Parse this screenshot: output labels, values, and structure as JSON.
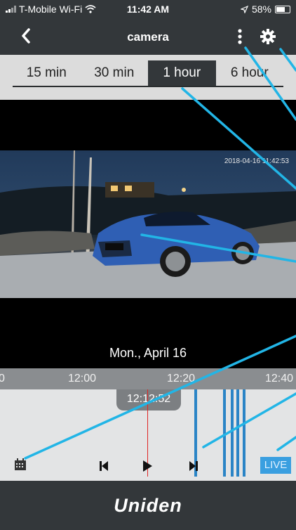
{
  "status_bar": {
    "carrier": "T-Mobile Wi-Fi",
    "time": "11:42 AM",
    "battery": "58%",
    "battery_level": 0.58
  },
  "nav": {
    "title": "camera",
    "icons": [
      "back-chevron",
      "more-vertical",
      "gear"
    ]
  },
  "range_tabs": {
    "items": [
      {
        "label": "15 min"
      },
      {
        "label": "30 min"
      },
      {
        "label": "1 hour"
      },
      {
        "label": "6 hour"
      }
    ],
    "active_index": 2
  },
  "video": {
    "timestamp": "2018-04-16 11:42:53",
    "date_label": "Mon., April 16"
  },
  "timeline": {
    "scale_labels": [
      "12:00",
      "12:20",
      "12:40"
    ],
    "partial_label": "0",
    "current_time": "12:12:52",
    "live_label": "LIVE",
    "icons": [
      "calendar",
      "skip-previous",
      "play",
      "skip-next"
    ]
  },
  "footer": {
    "brand": "Uniden"
  },
  "colors": {
    "bar": "#33373a",
    "accent": "#2a84c6",
    "live": "#3a9fe0",
    "callout": "#22b5e6",
    "marker": "#e02525"
  }
}
